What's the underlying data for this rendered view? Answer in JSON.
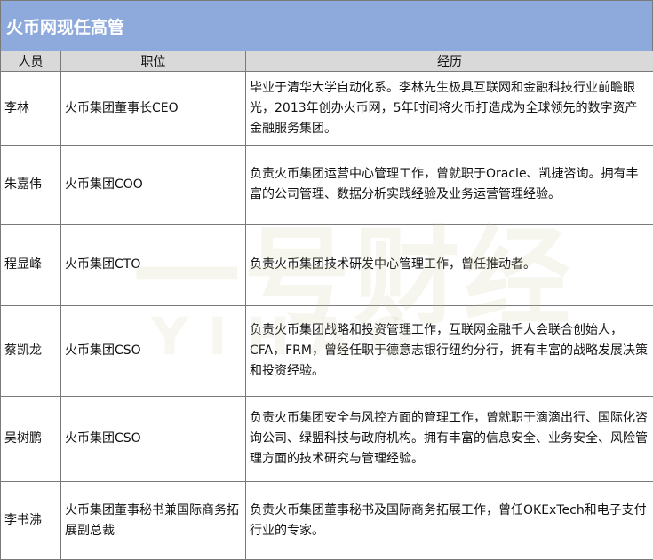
{
  "title": "火币网现任高管",
  "headers": {
    "person": "人员",
    "position": "职位",
    "experience": "经历"
  },
  "rows": [
    {
      "person": "李林",
      "position": "火币集团董事长CEO",
      "experience": "毕业于清华大学自动化系。李林先生极具互联网和金融科技行业前瞻眼光，2013年创办火币网，5年时间将火币打造成为全球领先的数字资产金融服务集团。"
    },
    {
      "person": "朱嘉伟",
      "position": "火币集团COO",
      "experience": "负责火币集团运营中心管理工作，曾就职于Oracle、凯捷咨询。拥有丰富的公司管理、数据分析实践经验及业务运营管理经验。"
    },
    {
      "person": "程显峰",
      "position": "火币集团CTO",
      "experience": "负责火币集团技术研发中心管理工作，曾任推动者。"
    },
    {
      "person": "蔡凯龙",
      "position": "火币集团CSO",
      "experience": "负责火币集团战略和投资管理工作，互联网金融千人会联合创始人，CFA，FRM，曾经任职于德意志银行纽约分行，拥有丰富的战略发展决策和投资经验。"
    },
    {
      "person": "吴树鹏",
      "position": "火币集团CSO",
      "experience": "负责火币集团安全与风控方面的管理工作，曾就职于滴滴出行、国际化咨询公司、绿盟科技与政府机构。拥有丰富的信息安全、业务安全、风险管理方面的技术研究与管理经验。"
    },
    {
      "person": "李书沸",
      "position": "火币集团董事秘书兼国际商务拓展副总裁",
      "experience": "负责火币集团董事秘书及国际商务拓展工作，曾任OKExTech和电子支付行业的专家。"
    }
  ],
  "watermark": {
    "cn": "一号财经",
    "en": "YIHAO"
  }
}
